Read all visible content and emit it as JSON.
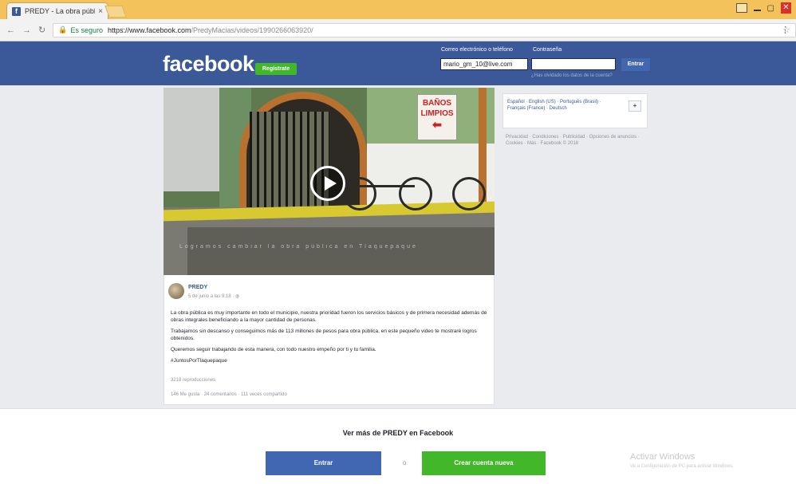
{
  "browser": {
    "tab_title": "PREDY - La obra pública ...",
    "tab_favicon": "f",
    "tab_close": "×",
    "secure_label": "Es seguro",
    "url_host": "https://www.facebook.com",
    "url_path": "/PredyMacias/videos/1990266063920/"
  },
  "header": {
    "logo": "facebook",
    "signup_badge": "Regístrate",
    "email_label": "Correo electrónico o teléfono",
    "password_label": "Contraseña",
    "email_value": "mario_gm_10@live.com",
    "forgot": "¿Has olvidado los datos de la cuenta?",
    "login": "Entrar"
  },
  "video": {
    "sign_line1": "BAÑOS",
    "sign_line2": "LIMPIOS",
    "sign_arrow": "⬅",
    "caption": "Logramos cambiar la obra pública en Tlaquepaque"
  },
  "post": {
    "author": "PREDY",
    "date": "5 de junio a las 9:18",
    "globe": "· ◍",
    "paragraphs": [
      "La obra pública es muy importante en todo el municipio, nuestra prioridad fueron los servicios básicos y de primera necesidad además de obras integrales beneficiando a la mayor cantidad de personas.",
      "Trabajamos sin descanso y conseguimos más de 113 millones de pesos para obra pública, en este pequeño video te mostraré logros obtenidos.",
      "Queremos seguir trabajando de esta manera, con todo nuestro empeño por ti y tu familia.",
      "#JuntosPorTlaquepaque"
    ],
    "reproductions": "3218 reproducciones",
    "stats": "146 Me gusta · 24 comentarios · 111 veces compartido"
  },
  "sidebar": {
    "languages": "Español · English (US) · Português (Brasil) · Français (France) · Deutsch",
    "add_language": "+",
    "footer": "Privacidad · Condiciones · Publicidad · Opciones de anuncios · Cookies · Más · Facebook © 2018"
  },
  "bottom": {
    "more_text": "Ver más de PREDY en Facebook",
    "login": "Entrar",
    "or": "o",
    "create": "Crear cuenta nueva",
    "windows_title": "Activar Windows",
    "windows_sub": "Ve a Configuración de PC para activar Windows."
  },
  "colors": {
    "facebook_blue": "#3b5998",
    "green": "#42b72a",
    "tabstrip": "#f3c25b"
  }
}
